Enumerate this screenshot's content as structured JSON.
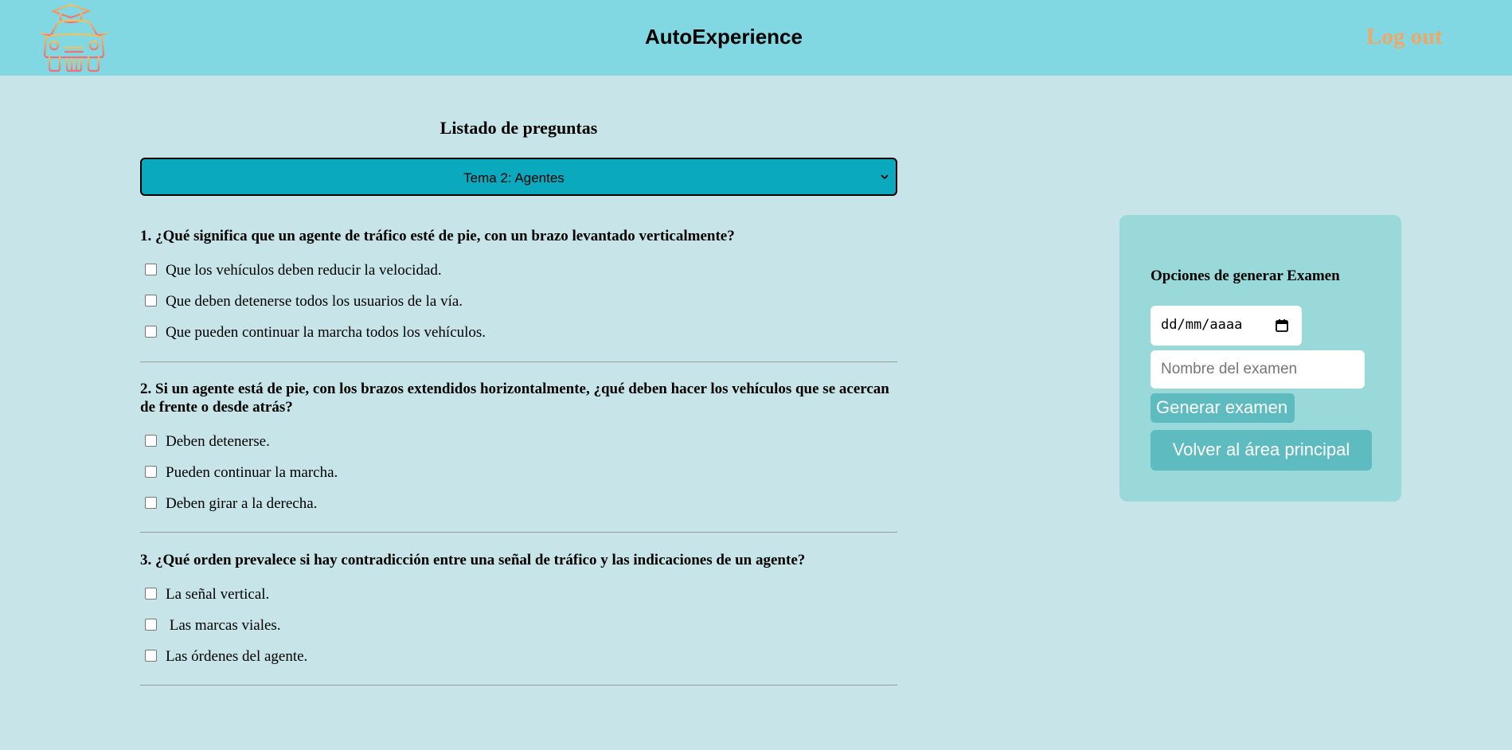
{
  "header": {
    "title": "AutoExperience",
    "logout_label": "Log out",
    "logo_icon": "car-graduation-cap-icon",
    "colors": {
      "bar": "#82d8e2",
      "logout": "#eea86a"
    }
  },
  "main": {
    "title": "Listado de preguntas",
    "topic_select": {
      "selected": "Tema 2: Agentes"
    },
    "questions": [
      {
        "text": "1. ¿Qué significa que un agente de tráfico esté de pie, con un brazo levantado verticalmente?",
        "options": [
          "Que los vehículos deben reducir la velocidad.",
          "Que deben detenerse todos los usuarios de la vía.",
          "Que pueden continuar la marcha todos los vehículos."
        ]
      },
      {
        "text": "2. Si un agente está de pie, con los brazos extendidos horizontalmente, ¿qué deben hacer los vehículos que se acercan de frente o desde atrás?",
        "options": [
          "Deben detenerse.",
          "Pueden continuar la marcha.",
          "Deben girar a la derecha."
        ]
      },
      {
        "text": "3. ¿Qué orden prevalece si hay contradicción entre una señal de tráfico y las indicaciones de un agente?",
        "options": [
          "La señal vertical.",
          " Las marcas viales.",
          "Las órdenes del agente."
        ]
      }
    ]
  },
  "panel": {
    "title": "Opciones de generar Examen",
    "date_input": {
      "value": "dd/mm/aaaa"
    },
    "name_input": {
      "placeholder": "Nombre del examen"
    },
    "generate_label": "Generar examen",
    "back_label": "Volver al área principal",
    "colors": {
      "panel": "#99d9da",
      "button": "#5ebbbf"
    }
  }
}
